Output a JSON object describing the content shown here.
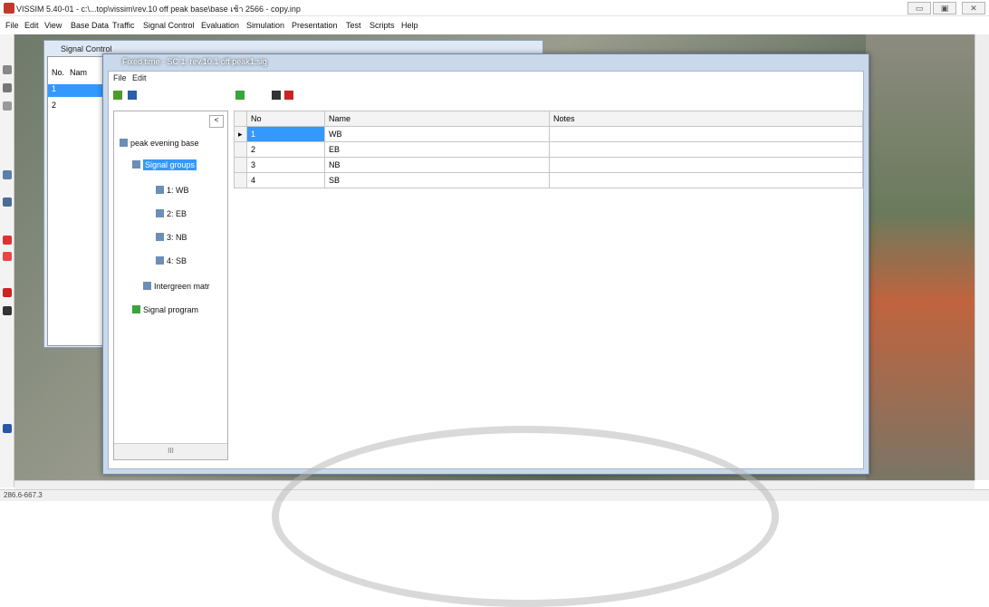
{
  "app": {
    "title": "VISSIM 5.40-01 - c:\\...top\\vissim\\rev.10  off peak base\\base เช้า 2566 - copy.inp"
  },
  "menu": [
    "File",
    "Edit",
    "View",
    "Base Data",
    "Traffic",
    "Signal Control",
    "Evaluation",
    "Simulation",
    "Presentation",
    "Test",
    "Scripts",
    "Help"
  ],
  "signal_control": {
    "title": "Signal Control",
    "cols": [
      "No.",
      "Nam"
    ],
    "rows": [
      "1",
      "2"
    ]
  },
  "fixed_time": {
    "title": "Fixed time - SC 1: rev.10.1 off peak1.sig",
    "menu": [
      "File",
      "Edit"
    ],
    "tree": {
      "root": "peak evening base",
      "groups": "Signal groups",
      "items": [
        "1: WB",
        "2: EB",
        "3: NB",
        "4: SB"
      ],
      "intergreen": "Intergreen matr",
      "programs": "Signal program"
    },
    "grid": {
      "headers": [
        "No",
        "Name",
        "Notes"
      ],
      "rows": [
        {
          "no": "1",
          "name": "WB",
          "notes": ""
        },
        {
          "no": "2",
          "name": "EB",
          "notes": ""
        },
        {
          "no": "3",
          "name": "NB",
          "notes": ""
        },
        {
          "no": "4",
          "name": "SB",
          "notes": ""
        }
      ]
    },
    "collapse_label": "<",
    "scroll_label": "III"
  },
  "status": {
    "coords": "286.6-667.3"
  },
  "controls": {
    "min": "▭",
    "max": "▣",
    "close": "✕"
  }
}
